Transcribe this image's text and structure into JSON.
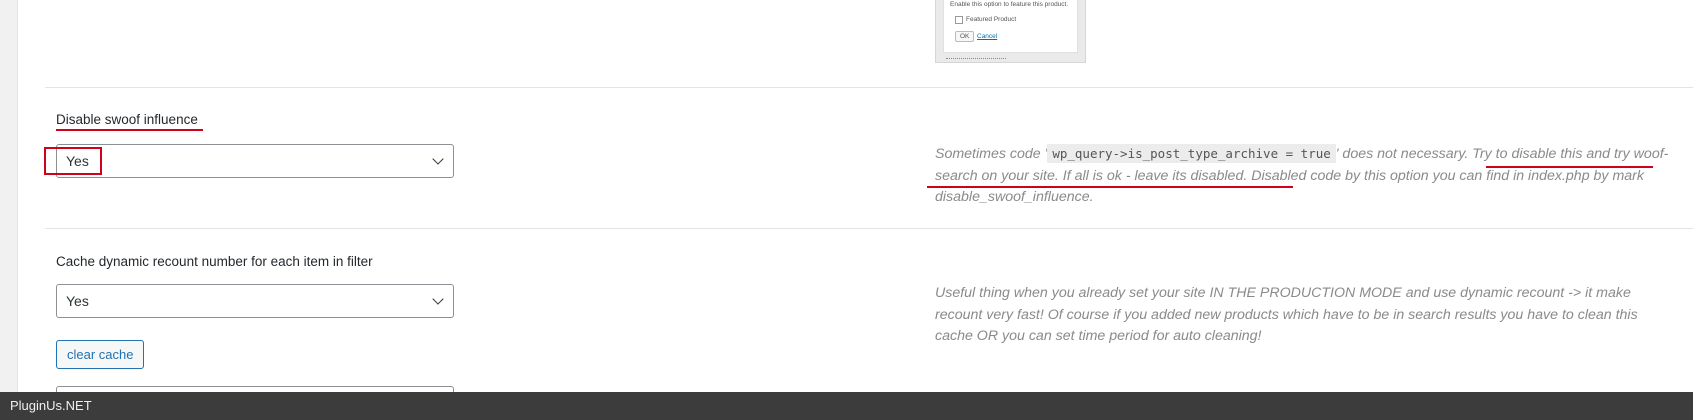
{
  "preview": {
    "hint_text": "Enable this option to feature this product.",
    "checkbox_label": "Featured Product",
    "ok_label": "OK",
    "cancel_label": "Cancel"
  },
  "settings": [
    {
      "title": "Disable swoof influence",
      "selected": "Yes",
      "desc": {
        "part1": "Sometimes code '",
        "code": "wp_query->is_post_type_archive = true",
        "part2": "' does not necessary. ",
        "highlighted": "Try to disable this and try woof-search on your site. If all is ok - leave its disabled.",
        "part3": " Disabled code by this option you can find in index.php by mark disable_swoof_influence."
      }
    },
    {
      "title": "Cache dynamic recount number for each item in filter",
      "selected": "Yes",
      "desc": "Useful thing when you already set your site IN THE PRODUCTION MODE and use dynamic recount -> it make recount very fast! Of course if you added new products which have to be in search results you have to clean this cache OR you can set time period for auto cleaning!",
      "button_label": "clear cache"
    }
  ],
  "footer": {
    "brand": "PluginUs.NET"
  },
  "colors": {
    "annotation": "#d0021b",
    "footer_bg": "#3c3c3c",
    "button": "#2271b1"
  }
}
